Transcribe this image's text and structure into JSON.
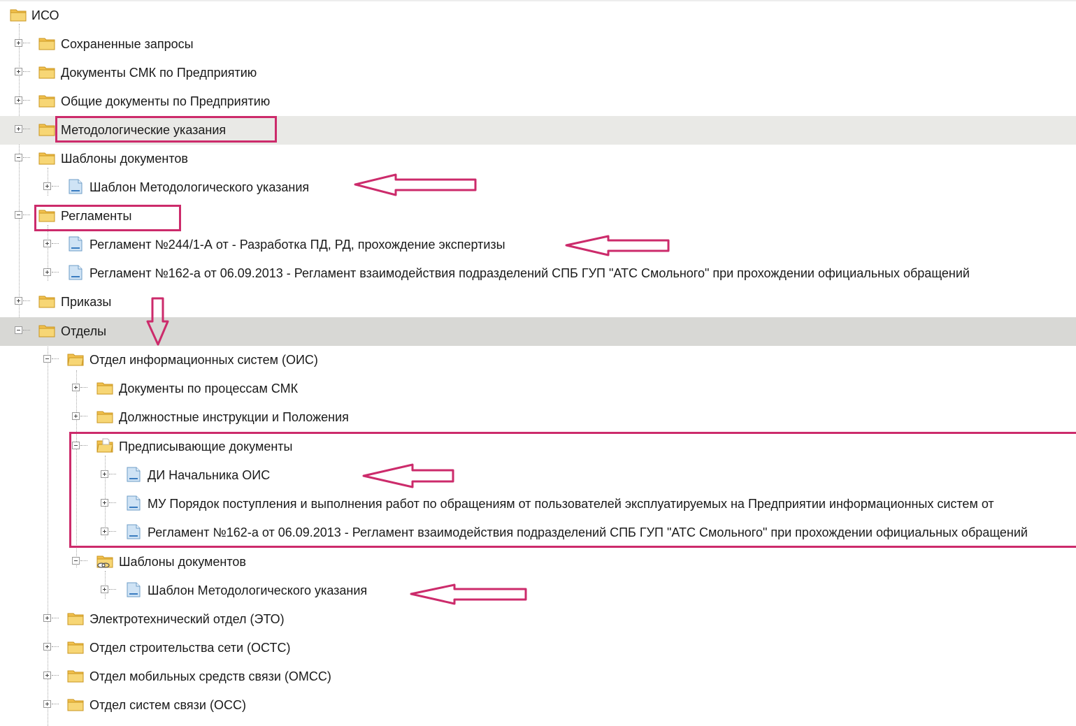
{
  "tree": {
    "root": "ИСО",
    "items": [
      {
        "label": "Сохраненные запросы",
        "icon": "folder-icon"
      },
      {
        "label": "Документы СМК по Предприятию",
        "icon": "folder-icon"
      },
      {
        "label": "Общие документы по Предприятию",
        "icon": "folder-icon"
      },
      {
        "label": "Методологические указания",
        "icon": "folder-icon"
      },
      {
        "label": "Шаблоны документов",
        "icon": "folder-icon"
      },
      {
        "label": "Шаблон Методологического указания",
        "icon": "document-icon"
      },
      {
        "label": "Регламенты",
        "icon": "folder-icon"
      },
      {
        "label": "Регламент №244/1-А от  - Разработка ПД, РД, прохождение экспертизы",
        "icon": "document-icon"
      },
      {
        "label": "Регламент №162-а от 06.09.2013 - Регламент взаимодействия подразделений СПБ ГУП \"АТС Смольного\" при прохождении официальных обращений",
        "icon": "document-icon"
      },
      {
        "label": "Приказы",
        "icon": "folder-icon"
      },
      {
        "label": "Отделы",
        "icon": "folder-icon"
      },
      {
        "label": "Отдел информационных систем (ОИС)",
        "icon": "folder-open-icon"
      },
      {
        "label": "Документы по процессам СМК",
        "icon": "folder-icon"
      },
      {
        "label": "Должностные инструкции и Положения",
        "icon": "folder-icon"
      },
      {
        "label": "Предписывающие документы",
        "icon": "folder-open-icon"
      },
      {
        "label": "ДИ Начальника ОИС",
        "icon": "document-icon"
      },
      {
        "label": "МУ Порядок поступления и выполнения работ по обращениям от пользователей эксплуатируемых на Предприятии информационных систем от",
        "icon": "document-icon"
      },
      {
        "label": "Регламент №162-а от 06.09.2013 - Регламент взаимодействия подразделений СПБ ГУП \"АТС Смольного\" при прохождении официальных обращений",
        "icon": "document-icon"
      },
      {
        "label": "Шаблоны документов",
        "icon": "folder-shared-icon"
      },
      {
        "label": "Шаблон Методологического указания",
        "icon": "document-icon"
      },
      {
        "label": "Электротехнический отдел (ЭТО)",
        "icon": "folder-icon"
      },
      {
        "label": "Отдел строительства сети (ОСТС)",
        "icon": "folder-icon"
      },
      {
        "label": "Отдел мобильных средств связи (ОМСС)",
        "icon": "folder-icon"
      },
      {
        "label": "Отдел систем связи (ОСС)",
        "icon": "folder-icon"
      }
    ]
  },
  "colors": {
    "annotation": "#cc2b6b",
    "folder": "#f2c14e",
    "document": "#cfe3f5",
    "selected_row": "#e9e9e6"
  }
}
